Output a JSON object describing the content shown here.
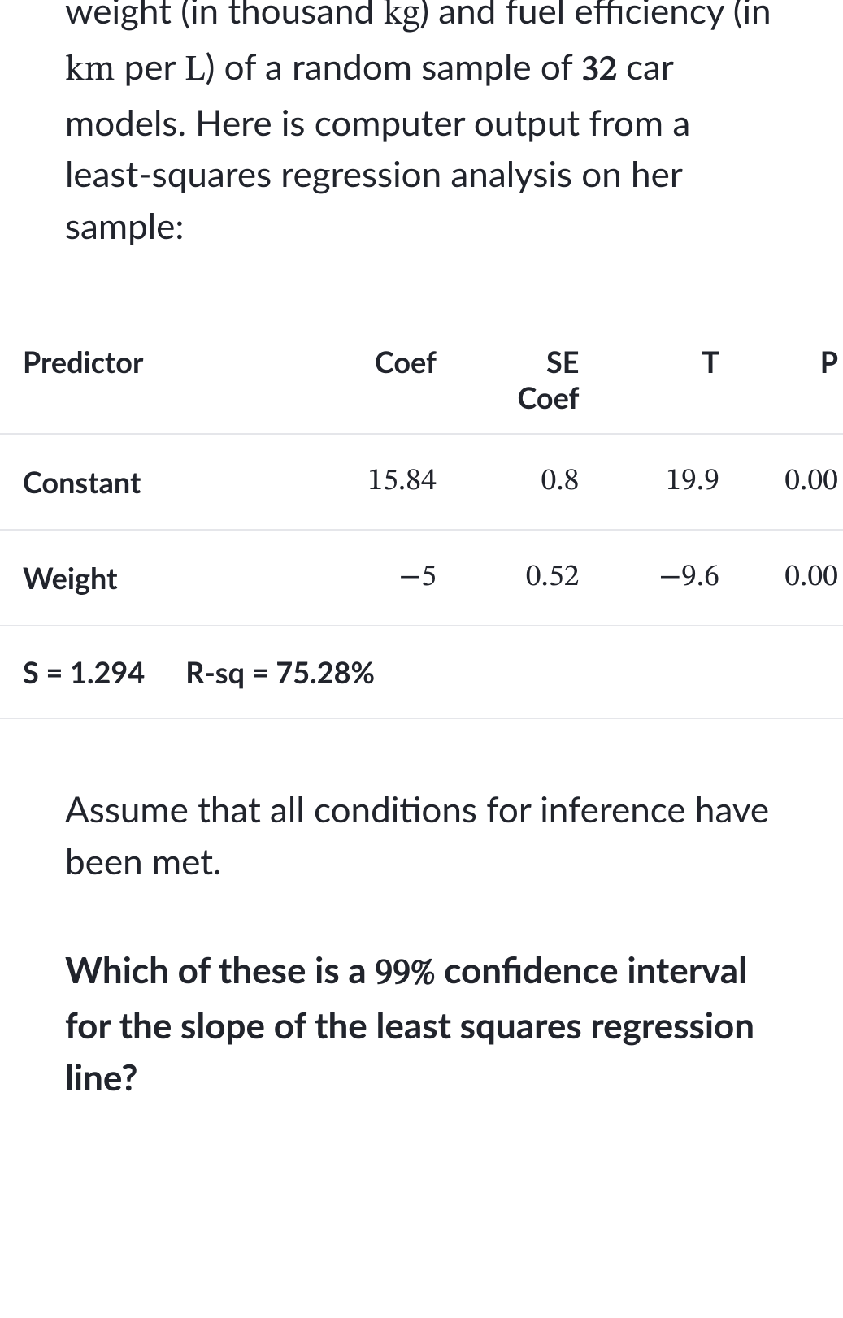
{
  "intro": {
    "pre": "weight (in thousand ",
    "unit1": "kg",
    "mid1": ") and fuel efficiency (in ",
    "unit2": "km",
    "mid2": " per ",
    "unit3": "L",
    "mid3": ") of a random sample of ",
    "n": "32",
    "post": " car models. Here is computer output from a least-squares regression analysis on her sample:"
  },
  "table": {
    "headers": {
      "predictor": "Predictor",
      "coef": "Coef",
      "se1": "SE",
      "se2": "Coef",
      "t": "T",
      "p": "P"
    },
    "rows": [
      {
        "predictor": "Constant",
        "coef": "15.84",
        "se": "0.8",
        "t": "19.9",
        "p": "0.00"
      },
      {
        "predictor": "Weight",
        "coef": "−5",
        "se": "0.52",
        "t": "−9.6",
        "p": "0.00"
      }
    ],
    "stats": {
      "s_label": "S = ",
      "s_value": "1.294",
      "rsq_label": "R-sq = ",
      "rsq_value": "75.28%"
    }
  },
  "assume": "Assume that all conditions for inference have been met.",
  "question": {
    "pre": "Which of these is a ",
    "pct": "99%",
    "post": " confidence interval for the slope of the least squares regression line?"
  },
  "chart_data": {
    "type": "table",
    "title": "Least-squares regression output",
    "columns": [
      "Predictor",
      "Coef",
      "SE Coef",
      "T",
      "P"
    ],
    "rows": [
      [
        "Constant",
        15.84,
        0.8,
        19.9,
        0.0
      ],
      [
        "Weight",
        -5,
        0.52,
        -9.6,
        0.0
      ]
    ],
    "S": 1.294,
    "R_sq_percent": 75.28,
    "n": 32
  }
}
